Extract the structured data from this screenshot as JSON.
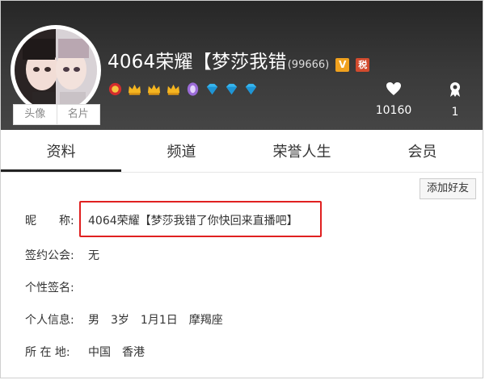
{
  "header": {
    "name": "4064荣耀【梦莎我错",
    "id_suffix": "(99666)",
    "badge_v": "V",
    "badge_r": "税",
    "avatar_buttons": [
      "头像",
      "名片"
    ],
    "medals": [
      "red-medal-icon",
      "crown-icon",
      "crown-icon",
      "crown-icon",
      "purple-gem-icon",
      "diamond-icon",
      "diamond-icon",
      "diamond-icon"
    ],
    "stats": {
      "likes": "10160",
      "rank": "1"
    }
  },
  "tabs": [
    "资料",
    "频道",
    "荣誉人生",
    "会员"
  ],
  "actions": {
    "add_friend": "添加好友"
  },
  "profile": {
    "nickname_label": "昵　　称:",
    "nickname_value": "4064荣耀【梦莎我错了你快回来直播吧】",
    "guild_label": "签约公会:",
    "guild_value": "无",
    "signature_label": "个性签名:",
    "signature_value": "",
    "personal_label": "个人信息:",
    "personal_value": "男　3岁　1月1日　摩羯座",
    "location_label": "所 在 地:",
    "location_value": "中国　香港"
  }
}
